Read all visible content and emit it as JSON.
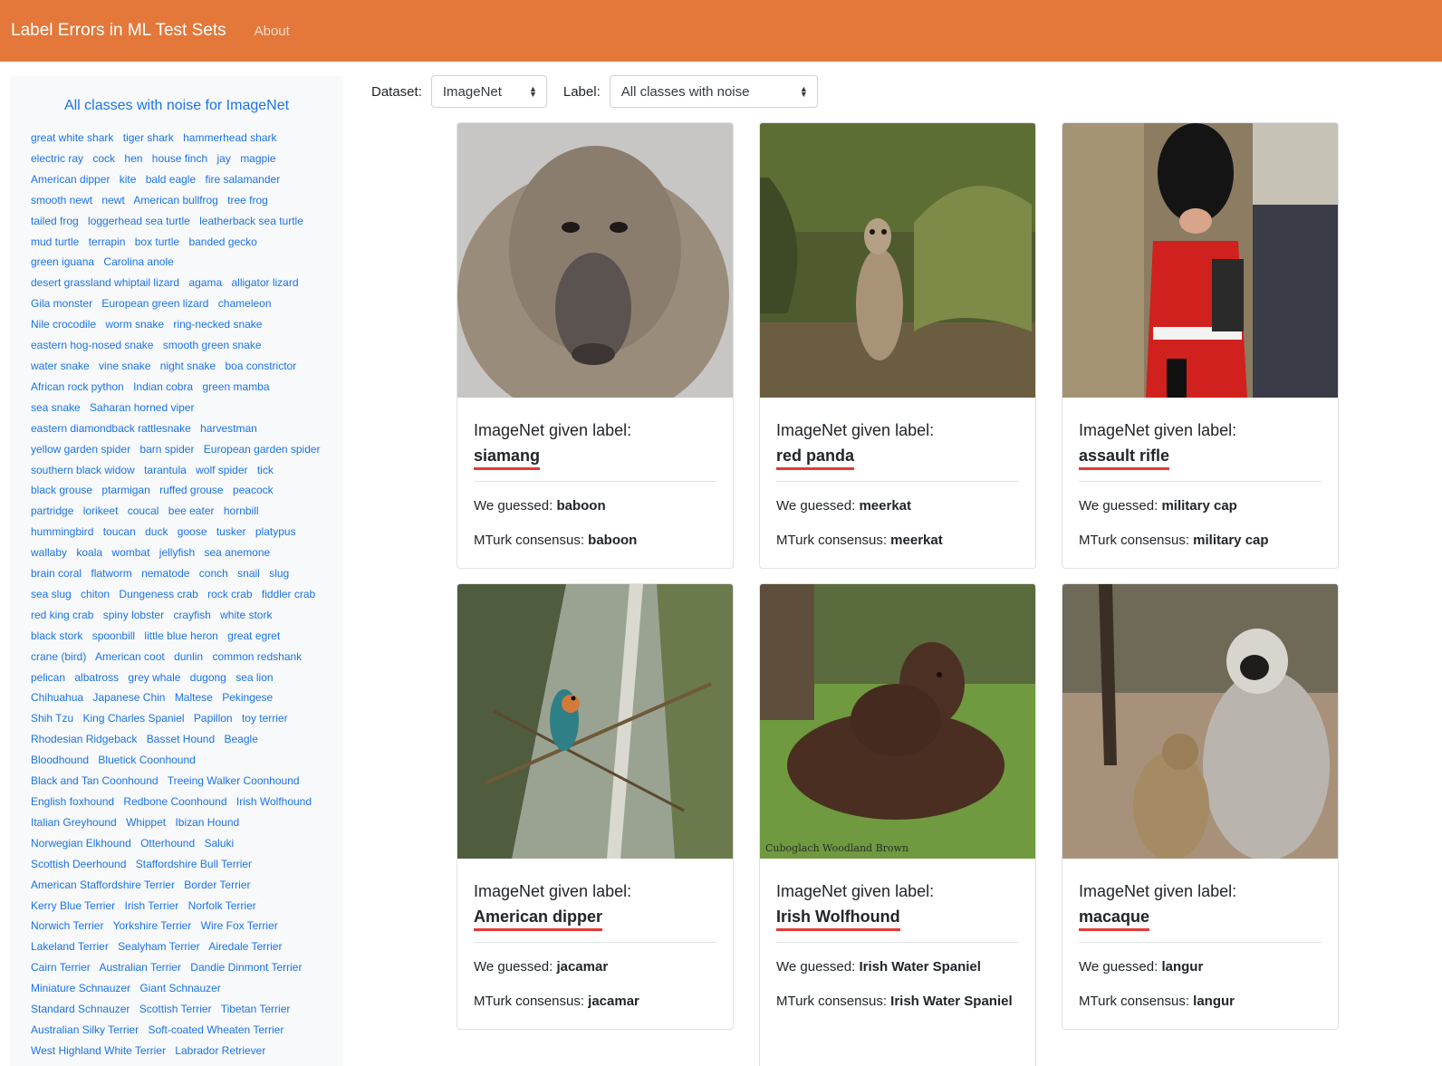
{
  "navbar": {
    "brand": "Label Errors in ML Test Sets",
    "about": "About"
  },
  "sidebar": {
    "title": "All classes with noise for ImageNet",
    "classes": [
      "great white shark",
      "tiger shark",
      "hammerhead shark",
      "electric ray",
      "cock",
      "hen",
      "house finch",
      "jay",
      "magpie",
      "American dipper",
      "kite",
      "bald eagle",
      "fire salamander",
      "smooth newt",
      "newt",
      "American bullfrog",
      "tree frog",
      "tailed frog",
      "loggerhead sea turtle",
      "leatherback sea turtle",
      "mud turtle",
      "terrapin",
      "box turtle",
      "banded gecko",
      "green iguana",
      "Carolina anole",
      "desert grassland whiptail lizard",
      "agama",
      "alligator lizard",
      "Gila monster",
      "European green lizard",
      "chameleon",
      "Nile crocodile",
      "worm snake",
      "ring-necked snake",
      "eastern hog-nosed snake",
      "smooth green snake",
      "water snake",
      "vine snake",
      "night snake",
      "boa constrictor",
      "African rock python",
      "Indian cobra",
      "green mamba",
      "sea snake",
      "Saharan horned viper",
      "eastern diamondback rattlesnake",
      "harvestman",
      "yellow garden spider",
      "barn spider",
      "European garden spider",
      "southern black widow",
      "tarantula",
      "wolf spider",
      "tick",
      "black grouse",
      "ptarmigan",
      "ruffed grouse",
      "peacock",
      "partridge",
      "lorikeet",
      "coucal",
      "bee eater",
      "hornbill",
      "hummingbird",
      "toucan",
      "duck",
      "goose",
      "tusker",
      "platypus",
      "wallaby",
      "koala",
      "wombat",
      "jellyfish",
      "sea anemone",
      "brain coral",
      "flatworm",
      "nematode",
      "conch",
      "snail",
      "slug",
      "sea slug",
      "chiton",
      "Dungeness crab",
      "rock crab",
      "fiddler crab",
      "red king crab",
      "spiny lobster",
      "crayfish",
      "white stork",
      "black stork",
      "spoonbill",
      "little blue heron",
      "great egret",
      "crane (bird)",
      "American coot",
      "dunlin",
      "common redshank",
      "pelican",
      "albatross",
      "grey whale",
      "dugong",
      "sea lion",
      "Chihuahua",
      "Japanese Chin",
      "Maltese",
      "Pekingese",
      "Shih Tzu",
      "King Charles Spaniel",
      "Papillon",
      "toy terrier",
      "Rhodesian Ridgeback",
      "Basset Hound",
      "Beagle",
      "Bloodhound",
      "Bluetick Coonhound",
      "Black and Tan Coonhound",
      "Treeing Walker Coonhound",
      "English foxhound",
      "Redbone Coonhound",
      "Irish Wolfhound",
      "Italian Greyhound",
      "Whippet",
      "Ibizan Hound",
      "Norwegian Elkhound",
      "Otterhound",
      "Saluki",
      "Scottish Deerhound",
      "Staffordshire Bull Terrier",
      "American Staffordshire Terrier",
      "Border Terrier",
      "Kerry Blue Terrier",
      "Irish Terrier",
      "Norfolk Terrier",
      "Norwich Terrier",
      "Yorkshire Terrier",
      "Wire Fox Terrier",
      "Lakeland Terrier",
      "Sealyham Terrier",
      "Airedale Terrier",
      "Cairn Terrier",
      "Australian Terrier",
      "Dandie Dinmont Terrier",
      "Miniature Schnauzer",
      "Giant Schnauzer",
      "Standard Schnauzer",
      "Scottish Terrier",
      "Tibetan Terrier",
      "Australian Silky Terrier",
      "Soft-coated Wheaten Terrier",
      "West Highland White Terrier",
      "Labrador Retriever"
    ]
  },
  "controls": {
    "dataset_label": "Dataset:",
    "dataset_value": "ImageNet",
    "label_label": "Label:",
    "label_value": "All classes with noise"
  },
  "card_text": {
    "given_prefix": "ImageNet given label:",
    "guess_prefix": "We guessed:",
    "mturk_prefix": "MTurk consensus:"
  },
  "cards": [
    {
      "given": "siamang",
      "guess": "baboon",
      "mturk": "baboon"
    },
    {
      "given": "red panda",
      "guess": "meerkat",
      "mturk": "meerkat"
    },
    {
      "given": "assault rifle",
      "guess": "military cap",
      "mturk": "military cap"
    },
    {
      "given": "American dipper",
      "guess": "jacamar",
      "mturk": "jacamar"
    },
    {
      "given": "Irish Wolfhound",
      "guess": "Irish Water Spaniel",
      "mturk": "Irish Water Spaniel"
    },
    {
      "given": "macaque",
      "guess": "langur",
      "mturk": "langur"
    }
  ],
  "photo_caption": "Cuboglach Woodland Brown",
  "colors": {
    "navbar": "#e3783a",
    "link": "#1a73e8",
    "underline": "#e53935"
  }
}
